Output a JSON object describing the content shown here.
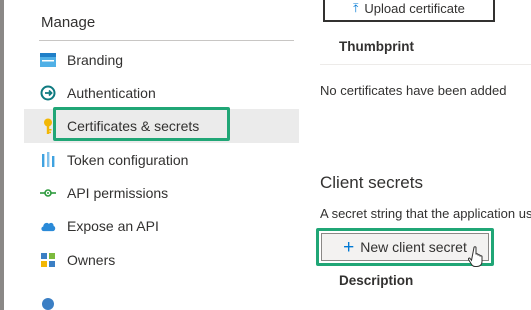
{
  "sidebar": {
    "section_title": "Manage",
    "items": [
      {
        "label": "Branding",
        "icon": "branding-icon"
      },
      {
        "label": "Authentication",
        "icon": "authentication-icon"
      },
      {
        "label": "Certificates & secrets",
        "icon": "key-icon",
        "selected": true
      },
      {
        "label": "Token configuration",
        "icon": "token-bars-icon"
      },
      {
        "label": "API permissions",
        "icon": "api-permissions-icon"
      },
      {
        "label": "Expose an API",
        "icon": "cloud-icon"
      },
      {
        "label": "Owners",
        "icon": "owners-grid-icon"
      }
    ]
  },
  "certificates": {
    "upload_label": "Upload certificate",
    "thumbprint_header": "Thumbprint",
    "empty_text": "No certificates have been added"
  },
  "client_secrets": {
    "title": "Client secrets",
    "description": "A secret string that the application uses",
    "new_button_label": "New client secret",
    "description_header": "Description"
  },
  "colors": {
    "highlight": "#20a676",
    "accent_blue": "#0078d4",
    "selected_bg": "#ebebeb"
  }
}
